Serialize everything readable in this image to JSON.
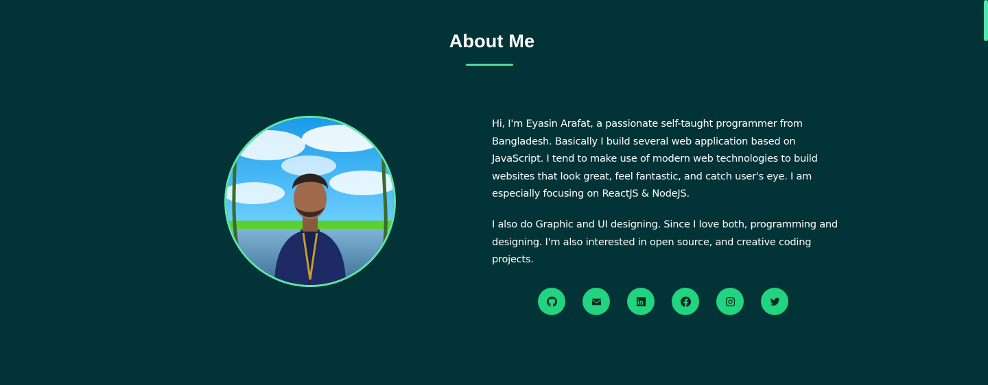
{
  "section": {
    "title": "About Me"
  },
  "profile": {
    "paragraphs": [
      "Hi, I'm Eyasin Arafat, a passionate self-taught programmer from Bangladesh. Basically I build several web application based on JavaScript. I tend to make use of modern web technologies to build websites that look great, feel fantastic, and catch user's eye. I am especially focusing on ReactJS & NodeJS.",
      "I also do Graphic and UI designing. Since I love both, programming and designing. I'm also interested in open source, and creative coding projects."
    ]
  },
  "socials": [
    {
      "icon": "github-icon"
    },
    {
      "icon": "email-icon"
    },
    {
      "icon": "linkedin-icon"
    },
    {
      "icon": "facebook-icon"
    },
    {
      "icon": "instagram-icon"
    },
    {
      "icon": "twitter-icon"
    }
  ],
  "colors": {
    "background": "#023336",
    "accent": "#22d37f",
    "underline": "#4ade9a",
    "text": "#ffffff"
  }
}
